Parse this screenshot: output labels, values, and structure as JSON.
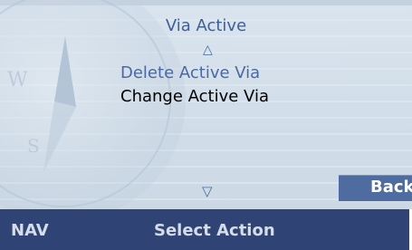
{
  "menu": {
    "title": "Via Active",
    "scroll_up_glyph": "△",
    "scroll_down_glyph": "▽",
    "items": [
      {
        "label": "Delete Active Via",
        "selected": false
      },
      {
        "label": "Change Active Via",
        "selected": true
      }
    ]
  },
  "back_button": {
    "label": "Back"
  },
  "status_bar": {
    "mode": "NAV",
    "prompt": "Select Action"
  },
  "colors": {
    "background": "#d2dee9",
    "accent_text": "#4a69a3",
    "selected_text": "#000000",
    "status_bar": "#2f4374",
    "button": "#4e6ca0"
  },
  "icons": [
    "compass-watermark-icon",
    "scroll-up-arrow-icon",
    "scroll-down-arrow-icon"
  ]
}
